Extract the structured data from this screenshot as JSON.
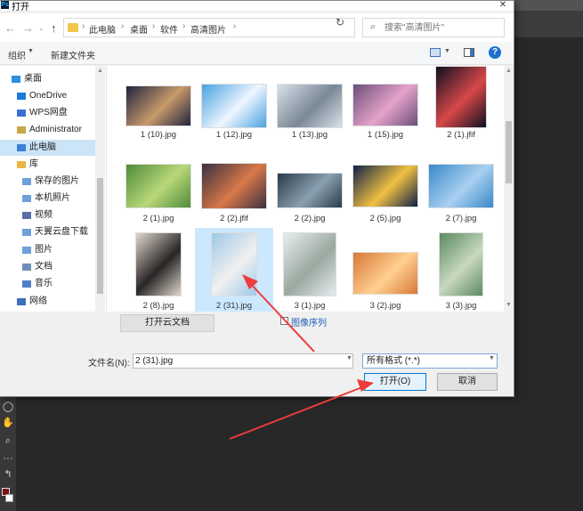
{
  "dialog": {
    "title": "打开",
    "title_icon": "Ps",
    "close": "✕"
  },
  "address": {
    "crumbs": [
      "此电脑",
      "桌面",
      "软件",
      "高清图片"
    ],
    "search_placeholder": "搜索\"高清图片\""
  },
  "toolbar": {
    "organize": "组织",
    "new_folder": "新建文件夹",
    "help": "?"
  },
  "nav": {
    "items": [
      {
        "label": "桌面",
        "icon": "desktop-icon",
        "color": "#2f8fe0"
      },
      {
        "label": "OneDrive",
        "icon": "cloud-icon",
        "color": "#1c7ad9"
      },
      {
        "label": "WPS网盘",
        "icon": "cloud-icon",
        "color": "#3a6fd8"
      },
      {
        "label": "Administrator",
        "icon": "user-icon",
        "color": "#c7a64a"
      },
      {
        "label": "此电脑",
        "icon": "computer-icon",
        "color": "#3b7fd4"
      },
      {
        "label": "库",
        "icon": "library-icon",
        "color": "#e8b545"
      },
      {
        "label": "保存的图片",
        "icon": "folder-icon",
        "color": "#6fa0d8"
      },
      {
        "label": "本机照片",
        "icon": "folder-icon",
        "color": "#6fa0d8"
      },
      {
        "label": "视频",
        "icon": "video-icon",
        "color": "#5b6fa8"
      },
      {
        "label": "天翼云盘下载",
        "icon": "folder-icon",
        "color": "#6fa0d8"
      },
      {
        "label": "图片",
        "icon": "image-icon",
        "color": "#6fa0d8"
      },
      {
        "label": "文档",
        "icon": "document-icon",
        "color": "#6f8fb8"
      },
      {
        "label": "音乐",
        "icon": "music-icon",
        "color": "#4f7fc8"
      },
      {
        "label": "网络",
        "icon": "network-icon",
        "color": "#3f6fb8"
      }
    ]
  },
  "files": [
    {
      "name": "1 (10).jpg",
      "colors": [
        "#1f2340",
        "#c89a6a"
      ]
    },
    {
      "name": "1 (12).jpg",
      "colors": [
        "#4aa2e0",
        "#eef6ff"
      ]
    },
    {
      "name": "1 (13).jpg",
      "colors": [
        "#d8e2ea",
        "#7a8896"
      ]
    },
    {
      "name": "1 (15).jpg",
      "colors": [
        "#6b4f7c",
        "#e5a3c8"
      ]
    },
    {
      "name": "2 (1).jfif",
      "colors": [
        "#0e1020",
        "#d84848"
      ]
    },
    {
      "name": "2 (1).jpg",
      "colors": [
        "#4f8a3a",
        "#b8d878"
      ]
    },
    {
      "name": "2 (2).jfif",
      "colors": [
        "#3a3040",
        "#d8784a"
      ]
    },
    {
      "name": "2 (2).jpg",
      "colors": [
        "#2a3a4a",
        "#8aa0b0"
      ]
    },
    {
      "name": "2 (5).jpg",
      "colors": [
        "#10204a",
        "#f0c040"
      ]
    },
    {
      "name": "2 (7).jpg",
      "colors": [
        "#3a88c8",
        "#a8d0f0"
      ]
    },
    {
      "name": "2 (8).jpg",
      "colors": [
        "#e0d8d0",
        "#2a2626"
      ]
    },
    {
      "name": "2 (31).jpg",
      "colors": [
        "#9ec8e8",
        "#f0f0f0"
      ]
    },
    {
      "name": "3 (1).jpg",
      "colors": [
        "#e8eef0",
        "#9aa8a0"
      ]
    },
    {
      "name": "3 (2).jpg",
      "colors": [
        "#d87838",
        "#ffd090"
      ]
    },
    {
      "name": "3 (3).jpg",
      "colors": [
        "#5a8a60",
        "#c8d8c0"
      ]
    }
  ],
  "bottom": {
    "cloud_button": "打开云文档",
    "sequence_label": "图像序列",
    "filename_label": "文件名(N):",
    "filename_value": "2 (31).jpg",
    "filetype": "所有格式 (*.*)",
    "open_button": "打开(O)",
    "cancel_button": "取消"
  }
}
